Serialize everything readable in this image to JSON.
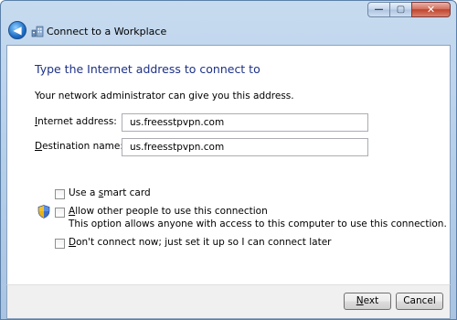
{
  "window": {
    "minimize": "—",
    "maximize": "▢",
    "close": "✕"
  },
  "wizard": {
    "back": "◀",
    "title": "Connect to a Workplace"
  },
  "page": {
    "heading": "Type the Internet address to connect to",
    "subtitle": "Your network administrator can give you this address."
  },
  "form": {
    "internet_address_label_pre": "",
    "internet_address_label_key": "I",
    "internet_address_label_post": "nternet address:",
    "internet_address_value": "us.freesstpvpn.com",
    "destination_label_pre": "",
    "destination_label_key": "D",
    "destination_label_post": "estination name:",
    "destination_value": "us.freesstpvpn.com"
  },
  "options": {
    "smart_card_pre": "Use a ",
    "smart_card_key": "s",
    "smart_card_post": "mart card",
    "allow_others_pre": "",
    "allow_others_key": "A",
    "allow_others_post": "llow other people to use this connection",
    "allow_others_note": "This option allows anyone with access to this computer to use this connection.",
    "dont_connect_pre": "",
    "dont_connect_key": "D",
    "dont_connect_post": "on't connect now; just set it up so I can connect later"
  },
  "buttons": {
    "next_key": "N",
    "next_post": "ext",
    "cancel": "Cancel"
  },
  "colors": {
    "heading": "#1e3287",
    "frame": "#b9d1ea"
  }
}
